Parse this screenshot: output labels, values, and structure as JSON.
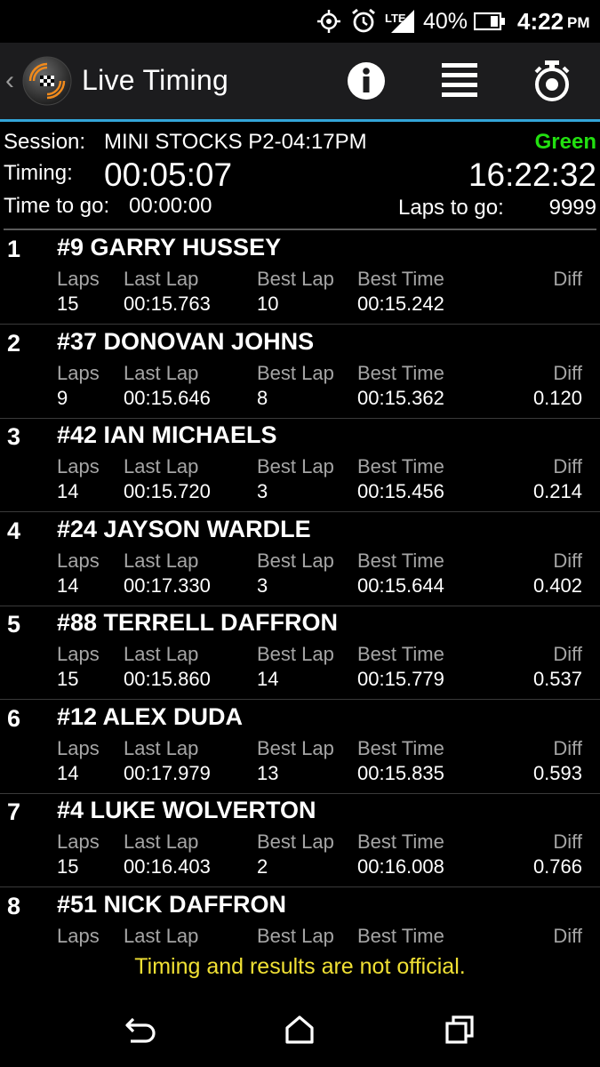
{
  "status_bar": {
    "network": "LTE",
    "battery_percent": "40%",
    "time": "4:22",
    "ampm": "PM",
    "icons": [
      "location-icon",
      "alarm-icon",
      "signal-icon",
      "battery-icon"
    ]
  },
  "app_bar": {
    "title": "Live Timing",
    "actions": [
      "info-icon",
      "list-icon",
      "stopwatch-icon"
    ]
  },
  "session": {
    "session_label": "Session:",
    "session_name": "MINI STOCKS P2-04:17PM",
    "flag": "Green",
    "flag_color": "#22e010",
    "timing_label": "Timing:",
    "timing_value": "00:05:07",
    "clock": "16:22:32",
    "time_to_go_label": "Time to go:",
    "time_to_go_value": "00:00:00",
    "laps_to_go_label": "Laps to go:",
    "laps_to_go_value": "9999"
  },
  "columns": {
    "laps": "Laps",
    "last_lap": "Last Lap",
    "best_lap": "Best Lap",
    "best_time": "Best Time",
    "diff": "Diff"
  },
  "results": [
    {
      "pos": "1",
      "driver": "#9 GARRY HUSSEY",
      "laps": "15",
      "last_lap": "00:15.763",
      "best_lap": "10",
      "best_time": "00:15.242",
      "diff": ""
    },
    {
      "pos": "2",
      "driver": "#37 DONOVAN JOHNS",
      "laps": "9",
      "last_lap": "00:15.646",
      "best_lap": "8",
      "best_time": "00:15.362",
      "diff": "0.120"
    },
    {
      "pos": "3",
      "driver": "#42 IAN MICHAELS",
      "laps": "14",
      "last_lap": "00:15.720",
      "best_lap": "3",
      "best_time": "00:15.456",
      "diff": "0.214"
    },
    {
      "pos": "4",
      "driver": "#24 JAYSON WARDLE",
      "laps": "14",
      "last_lap": "00:17.330",
      "best_lap": "3",
      "best_time": "00:15.644",
      "diff": "0.402"
    },
    {
      "pos": "5",
      "driver": "#88 TERRELL DAFFRON",
      "laps": "15",
      "last_lap": "00:15.860",
      "best_lap": "14",
      "best_time": "00:15.779",
      "diff": "0.537"
    },
    {
      "pos": "6",
      "driver": "#12 ALEX DUDA",
      "laps": "14",
      "last_lap": "00:17.979",
      "best_lap": "13",
      "best_time": "00:15.835",
      "diff": "0.593"
    },
    {
      "pos": "7",
      "driver": "#4 LUKE WOLVERTON",
      "laps": "15",
      "last_lap": "00:16.403",
      "best_lap": "2",
      "best_time": "00:16.008",
      "diff": "0.766"
    },
    {
      "pos": "8",
      "driver": "#51 NICK DAFFRON",
      "laps": "",
      "last_lap": "",
      "best_lap": "",
      "best_time": "",
      "diff": ""
    }
  ],
  "footer": {
    "note": "Timing and results are not official.",
    "note_color": "#f0e034"
  },
  "nav_bar": {
    "buttons": [
      "back-icon",
      "home-icon",
      "recents-icon"
    ]
  }
}
